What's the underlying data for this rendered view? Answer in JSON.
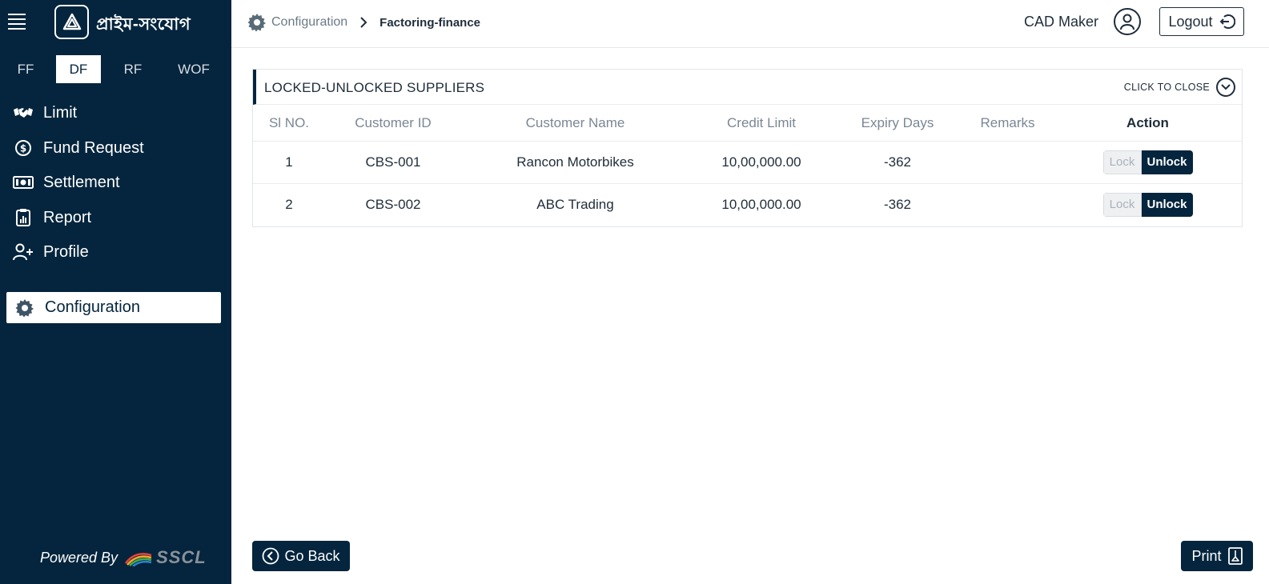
{
  "sidebar": {
    "brand": "প্রাইম-সংযোগ",
    "tabs": [
      {
        "label": "FF",
        "active": false
      },
      {
        "label": "DF",
        "active": true
      },
      {
        "label": "RF",
        "active": false
      },
      {
        "label": "WOF",
        "active": false
      }
    ],
    "menu": [
      {
        "label": "Limit",
        "icon": "handshake-icon"
      },
      {
        "label": "Fund Request",
        "icon": "dollar-circle-icon"
      },
      {
        "label": "Settlement",
        "icon": "cash-icon"
      },
      {
        "label": "Report",
        "icon": "clipboard-chart-icon"
      },
      {
        "label": "Profile",
        "icon": "user-plus-icon"
      }
    ],
    "active_item": {
      "label": "Configuration",
      "icon": "gear-icon"
    },
    "powered_by": "Powered By",
    "powered_brand": "SSCL"
  },
  "header": {
    "breadcrumb_home": "Configuration",
    "breadcrumb_current": "Factoring-finance",
    "user_name": "CAD Maker",
    "logout_label": "Logout"
  },
  "panel": {
    "title": "LOCKED-UNLOCKED SUPPLIERS",
    "toggle_label": "CLICK TO CLOSE",
    "columns": [
      "Sl NO.",
      "Customer ID",
      "Customer Name",
      "Credit Limit",
      "Expiry Days",
      "Remarks",
      "Action"
    ],
    "rows": [
      {
        "sl": "1",
        "customer_id": "CBS-001",
        "customer_name": "Rancon Motorbikes",
        "credit_limit": "10,00,000.00",
        "expiry_days": "-362",
        "remarks": "",
        "lock": "Lock",
        "unlock": "Unlock"
      },
      {
        "sl": "2",
        "customer_id": "CBS-002",
        "customer_name": "ABC Trading",
        "credit_limit": "10,00,000.00",
        "expiry_days": "-362",
        "remarks": "",
        "lock": "Lock",
        "unlock": "Unlock"
      }
    ]
  },
  "footer": {
    "go_back_label": "Go Back",
    "print_label": "Print"
  },
  "colors": {
    "sidebar_bg": "#04253d",
    "accent": "#04253d"
  }
}
